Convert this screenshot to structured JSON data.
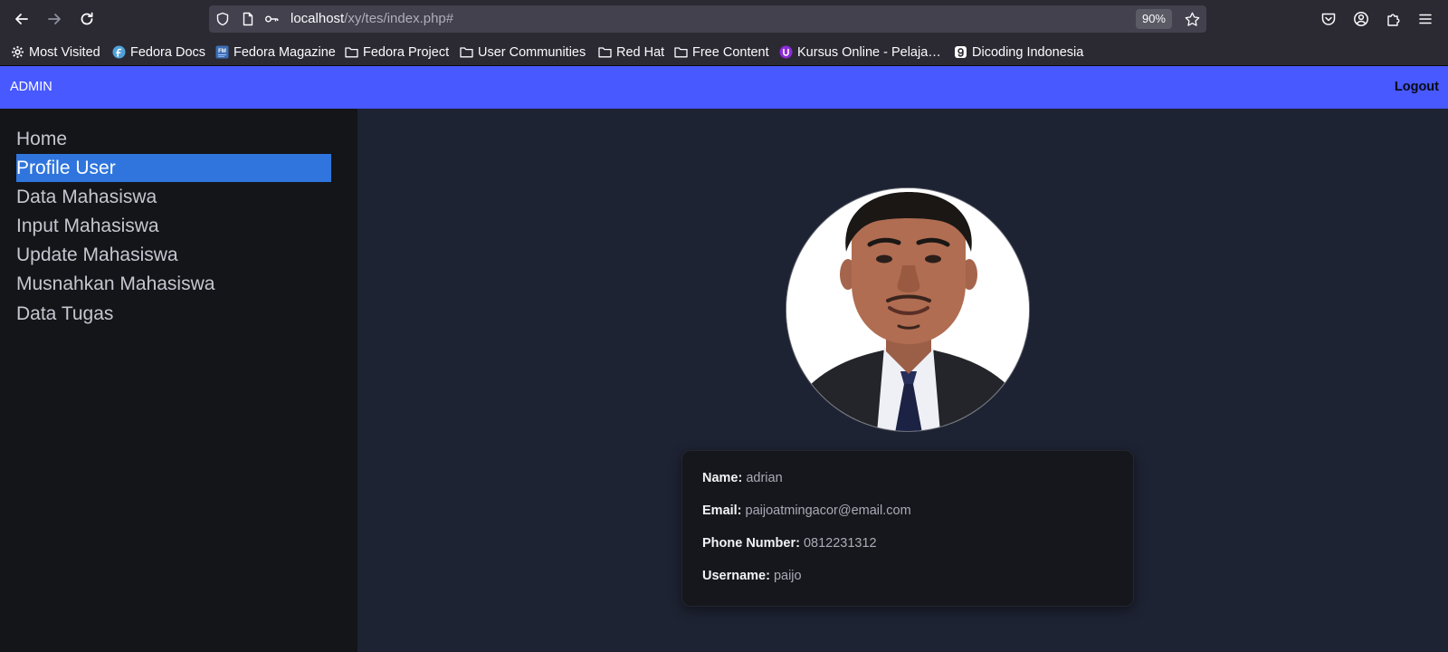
{
  "browser": {
    "url_host": "localhost",
    "url_path": "/xy/tes/index.php#",
    "zoom": "90%",
    "icons": [
      "back-icon",
      "forward-icon",
      "reload-icon",
      "shield-icon",
      "page-icon",
      "key-icon",
      "star-icon",
      "pocket-icon",
      "account-icon",
      "extensions-icon",
      "menu-icon"
    ],
    "bookmarks": [
      {
        "label": "Most Visited",
        "icon": "gear-icon"
      },
      {
        "label": "Fedora Docs",
        "icon": "fedora-icon"
      },
      {
        "label": "Fedora Magazine",
        "icon": "fm-icon"
      },
      {
        "label": "Fedora Project",
        "icon": "folder-icon"
      },
      {
        "label": "User Communities",
        "icon": "folder-icon"
      },
      {
        "label": "Red Hat",
        "icon": "folder-icon"
      },
      {
        "label": "Free Content",
        "icon": "folder-icon"
      },
      {
        "label": "Kursus Online - Pelaja…",
        "icon": "kursus-icon"
      },
      {
        "label": "Dicoding Indonesia",
        "icon": "dicoding-icon"
      }
    ]
  },
  "header": {
    "brand": "ADMIN",
    "logout": "Logout"
  },
  "sidebar": {
    "items": [
      {
        "label": "Home"
      },
      {
        "label": "Profile User",
        "active": true
      },
      {
        "label": "Data Mahasiswa"
      },
      {
        "label": "Input Mahasiswa"
      },
      {
        "label": "Update Mahasiswa"
      },
      {
        "label": "Musnahkan Mahasiswa"
      },
      {
        "label": "Data Tugas"
      }
    ]
  },
  "profile": {
    "fields": [
      {
        "label": "Name:",
        "value": "adrian"
      },
      {
        "label": "Email:",
        "value": "paijoatmingacor@email.com"
      },
      {
        "label": "Phone Number:",
        "value": "0812231312"
      },
      {
        "label": "Username:",
        "value": "paijo"
      }
    ]
  },
  "colors": {
    "topbar": "#4759ff",
    "sidebar": "#141519",
    "active_item": "#2f75dd",
    "main_bg": "#1e2333",
    "card_bg": "#15171c"
  }
}
